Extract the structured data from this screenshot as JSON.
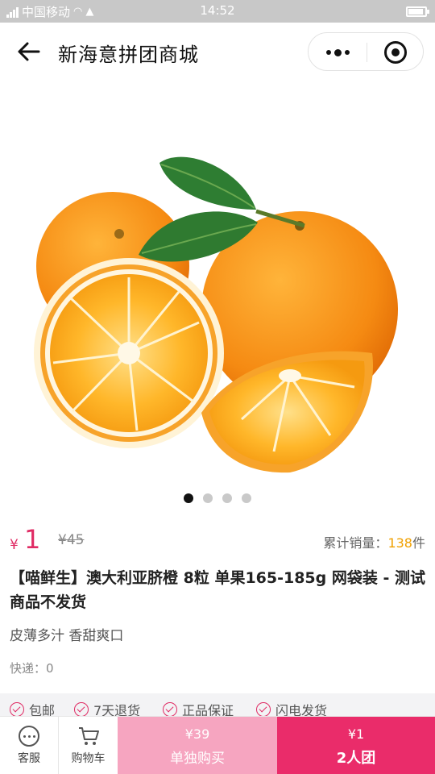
{
  "status_bar": {
    "carrier": "中国移动",
    "time": "14:52"
  },
  "nav": {
    "title": "新海意拼团商城"
  },
  "gallery": {
    "page_count": 4,
    "active_index": 0
  },
  "product": {
    "currency": "¥",
    "price": "1",
    "original_price": "¥45",
    "sales_label": "累计销量：",
    "sales_count": "138",
    "sales_unit": "件",
    "title": "【喵鲜生】澳大利亚脐橙 8粒 单果165-185g 网袋装 - 测试商品不发货",
    "subtitle": "皮薄多汁 香甜爽口",
    "shipping": "快递：0"
  },
  "services": [
    "包邮",
    "7天退货",
    "正品保证",
    "闪电发货"
  ],
  "bottom_bar": {
    "service_label": "客服",
    "cart_label": "购物车",
    "solo_price": "¥39",
    "solo_label": "单独购买",
    "group_price": "¥1",
    "group_label": "2人团"
  },
  "colors": {
    "accent": "#ea2c6a",
    "solo_bg": "#f6a5c0",
    "sales_highlight": "#f0a000"
  }
}
